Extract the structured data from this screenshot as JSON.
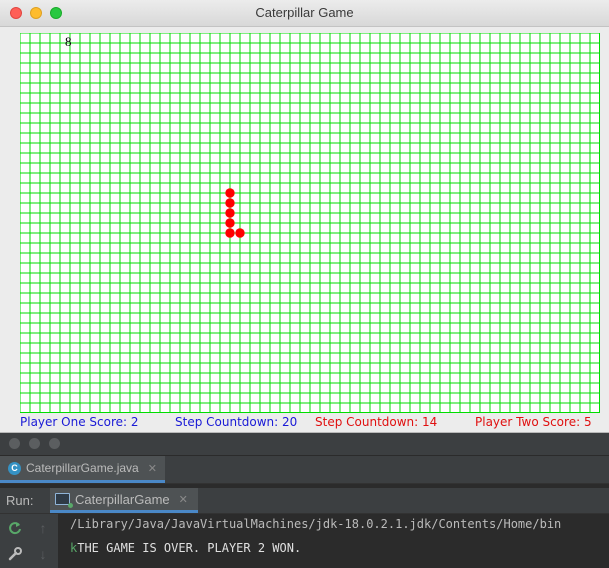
{
  "game_window": {
    "title": "Caterpillar Game",
    "counter": "8",
    "grid": {
      "cols": 58,
      "rows": 38,
      "line_color": "#00dd00"
    },
    "caterpillar": {
      "color": "#ff0000",
      "segments": [
        [
          21,
          16
        ],
        [
          21,
          17
        ],
        [
          21,
          18
        ],
        [
          21,
          19
        ],
        [
          21,
          20
        ],
        [
          22,
          20
        ]
      ]
    },
    "scores": {
      "player_one": "Player One Score: 2",
      "step_countdown_1": "Step Countdown: 20",
      "step_countdown_2": "Step Countdown: 14",
      "player_two": "Player Two Score: 5"
    }
  },
  "ide": {
    "file_tab": {
      "icon": "class-icon",
      "label": "CaterpillarGame.java"
    },
    "run": {
      "label": "Run:",
      "tab_label": "CaterpillarGame"
    },
    "console": {
      "line1": "/Library/Java/JavaVirtualMachines/jdk-18.0.2.1.jdk/Contents/Home/bin",
      "line2_prefix": "k",
      "line2": "THE GAME IS OVER. PLAYER 2 WON."
    }
  }
}
